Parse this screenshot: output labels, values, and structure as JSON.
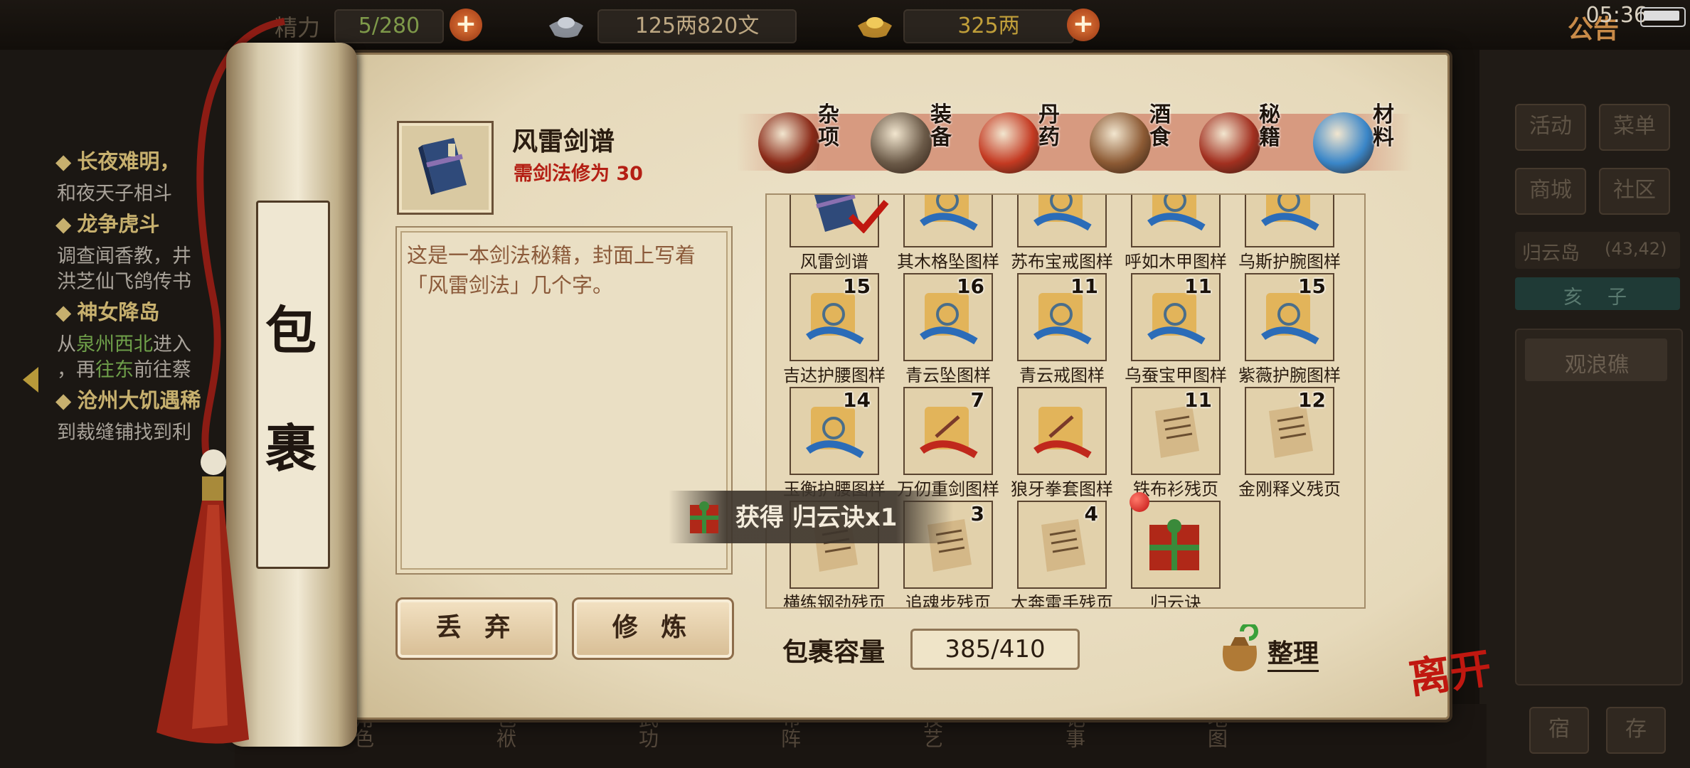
{
  "status": {
    "stamina": "5/280",
    "money": "125两820文",
    "gold": "325两",
    "notice": "公告",
    "time": "05:36"
  },
  "quests": [
    {
      "title": "长夜难明，",
      "desc": "和夜天子相斗"
    },
    {
      "title": "龙争虎斗",
      "desc": "调查闻香教，井",
      "desc2": "洪芝仙飞鸽传书"
    },
    {
      "title": "神女降岛",
      "desc_a": "从",
      "desc_hl": "泉州西北",
      "desc_b": "进入",
      "desc2_a": "，再",
      "desc2_hl": "往东",
      "desc2_b": "前往蔡"
    },
    {
      "title": "沧州大饥遇稀",
      "desc": "到裁缝铺找到利"
    }
  ],
  "side_panel": {
    "buttons": [
      "活动",
      "菜单",
      "商城",
      "社区"
    ],
    "location": "归云岛",
    "coords": "(43,42)",
    "time_chars": [
      "亥",
      "子"
    ],
    "place": "观浪礁",
    "bottom_buttons": [
      "宿",
      "存"
    ]
  },
  "dock": [
    "角色",
    "包袱",
    "武功",
    "布阵",
    "技艺",
    "记事",
    "地图"
  ],
  "inventory": {
    "roller_title": [
      "包",
      "裹"
    ],
    "selected": {
      "name": "风雷剑谱",
      "requirement": "需剑法修为 30",
      "description": "这是一本剑法秘籍，封面上写着「风雷剑法」几个字。"
    },
    "categories": [
      {
        "label": "杂项",
        "icon": "jar-icon",
        "color": "#8a2a18"
      },
      {
        "label": "装备",
        "icon": "gear-bundle-icon",
        "color": "#6b5a48"
      },
      {
        "label": "丹药",
        "icon": "pills-icon",
        "color": "#c43a22"
      },
      {
        "label": "酒食",
        "icon": "wine-food-icon",
        "color": "#8c5a34"
      },
      {
        "label": "秘籍",
        "icon": "books-icon",
        "color": "#a23020",
        "active": true
      },
      {
        "label": "材料",
        "icon": "crystal-icon",
        "color": "#3a86c8"
      }
    ],
    "items": [
      {
        "name": "风雷剑谱",
        "count": "",
        "kind": "book",
        "checked": true
      },
      {
        "name": "其木格坠图样",
        "count": "",
        "kind": "pattern"
      },
      {
        "name": "苏布宝戒图样",
        "count": "",
        "kind": "pattern"
      },
      {
        "name": "呼如木甲图样",
        "count": "",
        "kind": "pattern"
      },
      {
        "name": "乌斯护腕图样",
        "count": "",
        "kind": "pattern"
      },
      {
        "name": "吉达护腰图样",
        "count": "15",
        "kind": "pattern"
      },
      {
        "name": "青云坠图样",
        "count": "16",
        "kind": "pattern"
      },
      {
        "name": "青云戒图样",
        "count": "11",
        "kind": "pattern"
      },
      {
        "name": "乌蚕宝甲图样",
        "count": "11",
        "kind": "pattern"
      },
      {
        "name": "紫薇护腕图样",
        "count": "15",
        "kind": "pattern"
      },
      {
        "name": "玉衡护腰图样",
        "count": "14",
        "kind": "pattern"
      },
      {
        "name": "万仞重剑图样",
        "count": "7",
        "kind": "pattern-red"
      },
      {
        "name": "狼牙拳套图样",
        "count": "",
        "kind": "pattern-red"
      },
      {
        "name": "铁布衫残页",
        "count": "11",
        "kind": "page"
      },
      {
        "name": "金刚释义残页",
        "count": "12",
        "kind": "page"
      },
      {
        "name": "横练钢劲残页",
        "count": "",
        "kind": "page"
      },
      {
        "name": "追魂步残页",
        "count": "3",
        "kind": "page"
      },
      {
        "name": "大奔雷手残页",
        "count": "4",
        "kind": "page"
      },
      {
        "name": "归云诀",
        "count": "",
        "kind": "giftbook",
        "new": true
      }
    ],
    "discard_label": "丢 弃",
    "practice_label": "修 炼",
    "capacity_label": "包裹容量",
    "capacity_value": "385/410",
    "sort_label": "整理",
    "toast": "获得 归云诀x1",
    "leave_label": "离开"
  }
}
